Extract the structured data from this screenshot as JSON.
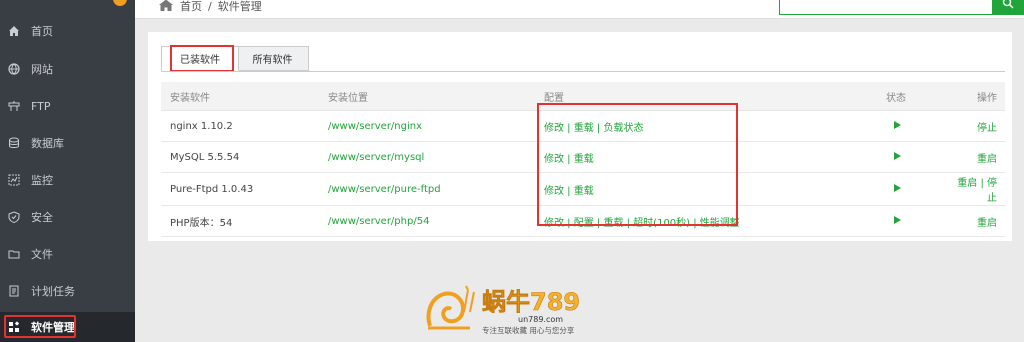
{
  "sidebar": {
    "items": [
      {
        "label": "首页",
        "icon": "home-icon"
      },
      {
        "label": "网站",
        "icon": "globe-icon"
      },
      {
        "label": "FTP",
        "icon": "ftp-icon"
      },
      {
        "label": "数据库",
        "icon": "database-icon"
      },
      {
        "label": "监控",
        "icon": "monitor-icon"
      },
      {
        "label": "安全",
        "icon": "shield-icon"
      },
      {
        "label": "文件",
        "icon": "folder-icon"
      },
      {
        "label": "计划任务",
        "icon": "task-icon"
      },
      {
        "label": "软件管理",
        "icon": "apps-icon",
        "active": true
      }
    ]
  },
  "breadcrumb": {
    "home": "首页",
    "separator": "/",
    "current": "软件管理"
  },
  "tabs": [
    {
      "label": "已装软件"
    },
    {
      "label": "所有软件"
    }
  ],
  "table": {
    "headers": [
      "安装软件",
      "安装位置",
      "配置",
      "状态",
      "操作"
    ],
    "rows": [
      {
        "name": "nginx 1.10.2",
        "path": "/www/server/nginx",
        "config": "修改 | 重载 | 负载状态",
        "status": "running",
        "action": "停止"
      },
      {
        "name": "MySQL 5.5.54",
        "path": "/www/server/mysql",
        "config": "修改 | 重载",
        "status": "running",
        "action": "重启"
      },
      {
        "name": "Pure-Ftpd 1.0.43",
        "path": "/www/server/pure-ftpd",
        "config": "修改 | 重载",
        "status": "running",
        "action": "重启 | 停止"
      },
      {
        "name": "PHP版本：54",
        "path": "/www/server/php/54",
        "config": "修改 | 配置 | 重载 | 超时(100秒) | 性能调整",
        "status": "running",
        "action": "重启"
      }
    ]
  },
  "watermark": {
    "brand": "蜗牛789",
    "domain": "un789.com",
    "slogan": "专注互联收藏 用心与您分享"
  },
  "colors": {
    "accent": "#20a53a",
    "highlight": "#e23232",
    "sidebar_bg": "#393d44"
  }
}
